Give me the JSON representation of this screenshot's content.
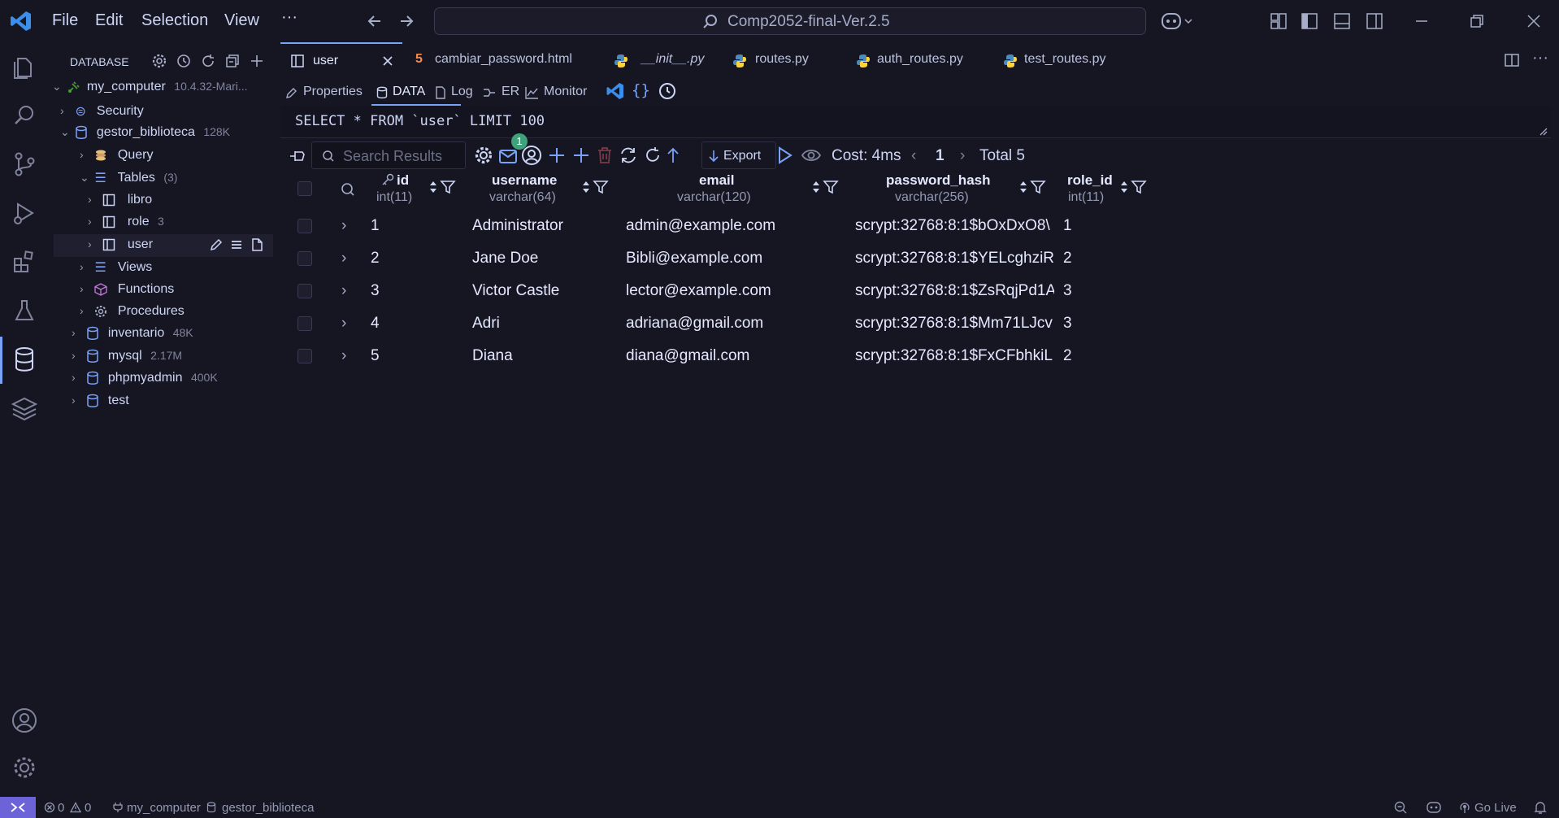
{
  "menu": [
    "File",
    "Edit",
    "Selection",
    "View"
  ],
  "more": "···",
  "command_center": "Comp2052-final-Ver.2.5",
  "sidebar": {
    "title": "DATABASE",
    "connection": {
      "name": "my_computer",
      "meta": "10.4.32-Mari..."
    },
    "items": [
      {
        "label": "Security",
        "meta": ""
      },
      {
        "label": "gestor_biblioteca",
        "meta": "128K"
      },
      {
        "label": "Query",
        "meta": ""
      },
      {
        "label": "Tables",
        "meta": "(3)"
      },
      {
        "label": "libro",
        "meta": ""
      },
      {
        "label": "role",
        "meta": "3"
      },
      {
        "label": "user",
        "meta": ""
      },
      {
        "label": "Views",
        "meta": ""
      },
      {
        "label": "Functions",
        "meta": ""
      },
      {
        "label": "Procedures",
        "meta": ""
      },
      {
        "label": "inventario",
        "meta": "48K"
      },
      {
        "label": "mysql",
        "meta": "2.17M"
      },
      {
        "label": "phpmyadmin",
        "meta": "400K"
      },
      {
        "label": "test",
        "meta": ""
      }
    ]
  },
  "tabs": [
    "user",
    "cambiar_password.html",
    "__init__.py",
    "routes.py",
    "auth_routes.py",
    "test_routes.py"
  ],
  "subtabs": [
    "Properties",
    "DATA",
    "Log",
    "ER",
    "Monitor"
  ],
  "query": "SELECT * FROM `user` LIMIT 100",
  "toolbar": {
    "search_placeholder": "Search Results",
    "badge": "1",
    "export": "Export",
    "cost": "Cost: 4ms",
    "page": "1",
    "total": "Total 5"
  },
  "columns": [
    {
      "name": "id",
      "type": "int(11)"
    },
    {
      "name": "username",
      "type": "varchar(64)"
    },
    {
      "name": "email",
      "type": "varchar(120)"
    },
    {
      "name": "password_hash",
      "type": "varchar(256)"
    },
    {
      "name": "role_id",
      "type": "int(11)"
    }
  ],
  "rows": [
    [
      "1",
      "Administrator",
      "admin@example.com",
      "scrypt:32768:8:1$bOxDxO8\\",
      "1"
    ],
    [
      "2",
      "Jane Doe",
      "Bibli@example.com",
      "scrypt:32768:8:1$YELcghziR",
      "2"
    ],
    [
      "3",
      "Victor Castle",
      "lector@example.com",
      "scrypt:32768:8:1$ZsRqjPd1A",
      "3"
    ],
    [
      "4",
      "Adri",
      "adriana@gmail.com",
      "scrypt:32768:8:1$Mm71LJcv",
      "3"
    ],
    [
      "5",
      "Diana",
      "diana@gmail.com",
      "scrypt:32768:8:1$FxCFbhkiL",
      "2"
    ]
  ],
  "status": {
    "errors": "0",
    "warnings": "0",
    "connection": "my_computer",
    "database": "gestor_biblioteca",
    "go_live": "Go Live"
  },
  "colors": {
    "accent": "#7aa2f7",
    "remote": "#6c63d9",
    "background": "#161623"
  }
}
